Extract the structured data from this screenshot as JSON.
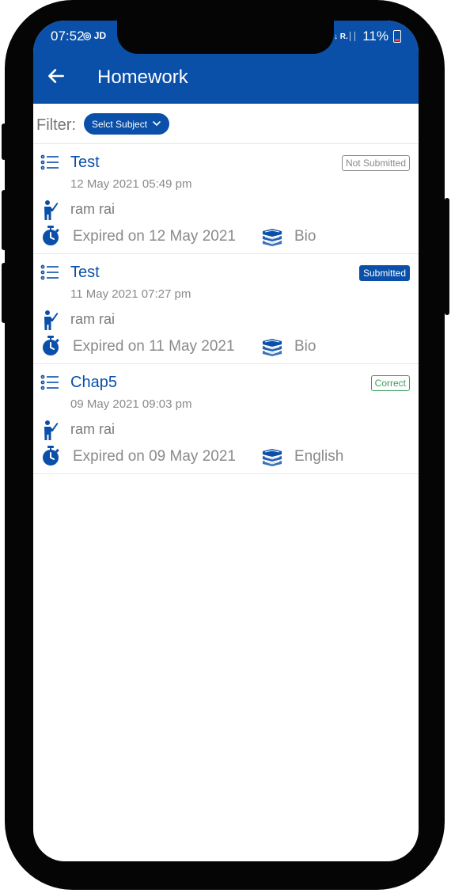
{
  "status_bar": {
    "time": "07:52",
    "left_icons": "◎ JD",
    "network": "4G ↑↓ R.││",
    "battery": "11%"
  },
  "header": {
    "title": "Homework"
  },
  "filter": {
    "label": "Filter:",
    "selected": "Selct Subject"
  },
  "homework": [
    {
      "title": "Test",
      "date": "12 May 2021 05:49 pm",
      "teacher": "ram rai",
      "expiry": "Expired on 12 May 2021",
      "subject": "Bio",
      "status": "Not Submitted"
    },
    {
      "title": "Test",
      "date": "11 May 2021 07:27 pm",
      "teacher": "ram rai",
      "expiry": "Expired on 11 May 2021",
      "subject": "Bio",
      "status": "Submitted"
    },
    {
      "title": "Chap5",
      "date": "09 May 2021 09:03 pm",
      "teacher": "ram rai",
      "expiry": "Expired on 09 May 2021",
      "subject": "English",
      "status": "Correct"
    }
  ],
  "colors": {
    "primary": "#0a4fa8",
    "not_submitted": "#8a8a8a",
    "correct": "#3c9a5f",
    "frame": "#050505"
  }
}
